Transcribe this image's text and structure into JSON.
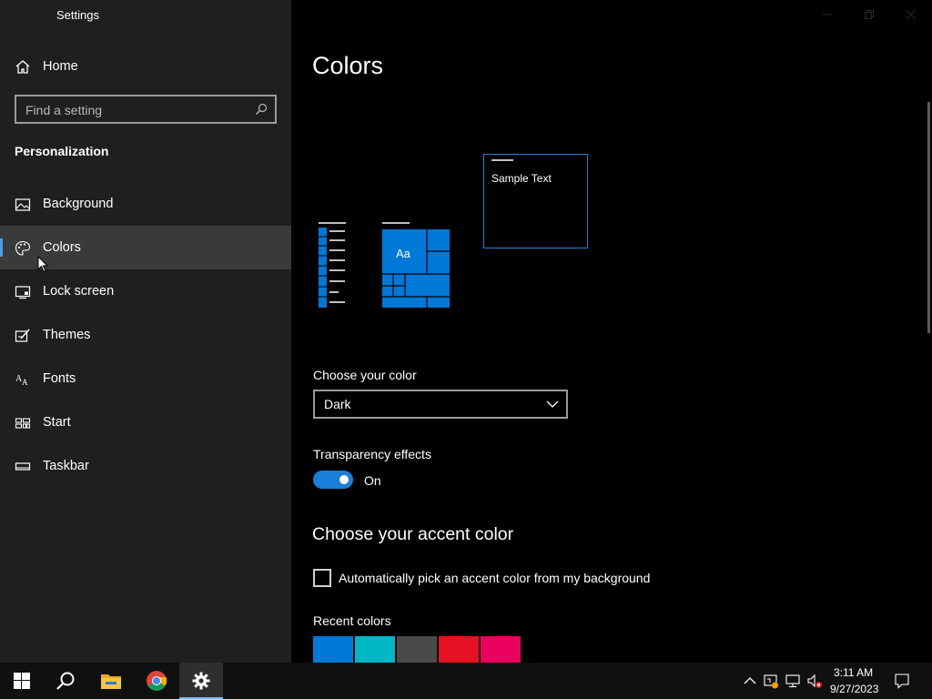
{
  "window": {
    "title": "Settings"
  },
  "sidebar": {
    "home_label": "Home",
    "search_placeholder": "Find a setting",
    "section_heading": "Personalization",
    "items": [
      {
        "label": "Background",
        "icon": "image-icon"
      },
      {
        "label": "Colors",
        "icon": "palette-icon",
        "selected": true
      },
      {
        "label": "Lock screen",
        "icon": "lock-screen-icon"
      },
      {
        "label": "Themes",
        "icon": "themes-brush-icon"
      },
      {
        "label": "Fonts",
        "icon": "fonts-icon"
      },
      {
        "label": "Start",
        "icon": "start-grid-icon"
      },
      {
        "label": "Taskbar",
        "icon": "taskbar-icon"
      }
    ]
  },
  "main": {
    "title": "Colors",
    "preview": {
      "sample_text": "Sample Text",
      "tile_text": "Aa"
    },
    "color_mode": {
      "label": "Choose your color",
      "value": "Dark"
    },
    "transparency": {
      "label": "Transparency effects",
      "state": "On",
      "enabled": true
    },
    "accent": {
      "heading": "Choose your accent color",
      "auto_label": "Automatically pick an accent color from my background",
      "auto_checked": false,
      "recent_label": "Recent colors",
      "recent_colors": [
        "#0078d7",
        "#00b7c3",
        "#4c4a48",
        "#e81123",
        "#ea005e"
      ]
    }
  },
  "taskbar": {
    "pinned": [
      "start-icon",
      "search-icon",
      "file-explorer-icon",
      "chrome-icon",
      "settings-icon"
    ],
    "clock": {
      "time": "3:11 AM",
      "date": "9/27/2023"
    }
  },
  "colors": {
    "accent": "#0078d7",
    "sidebar_bg": "#1f1f1f",
    "main_bg": "#000000"
  }
}
